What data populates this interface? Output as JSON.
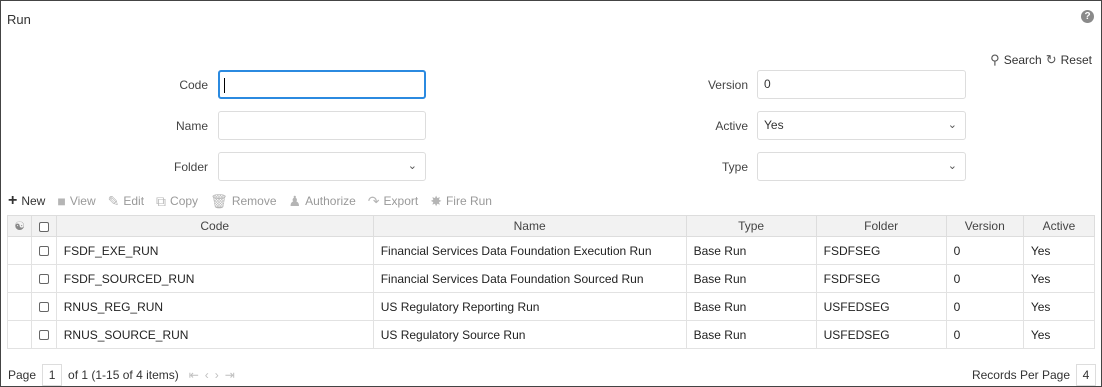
{
  "page": {
    "title": "Run",
    "help_icon": "question-icon"
  },
  "top_actions": {
    "search_label": "Search",
    "reset_label": "Reset"
  },
  "form": {
    "code_label": "Code",
    "code_value": "",
    "name_label": "Name",
    "name_value": "",
    "folder_label": "Folder",
    "folder_value": "",
    "version_label": "Version",
    "version_value": "0",
    "active_label": "Active",
    "active_value": "Yes",
    "type_label": "Type",
    "type_value": ""
  },
  "toolbar": {
    "new": "New",
    "view": "View",
    "edit": "Edit",
    "copy": "Copy",
    "remove": "Remove",
    "authorize": "Authorize",
    "export": "Export",
    "fire_run": "Fire Run"
  },
  "table": {
    "headers": [
      "Code",
      "Name",
      "Type",
      "Folder",
      "Version",
      "Active"
    ],
    "rows": [
      [
        "FSDF_EXE_RUN",
        "Financial Services Data Foundation Execution Run",
        "Base Run",
        "FSDFSEG",
        "0",
        "Yes"
      ],
      [
        "FSDF_SOURCED_RUN",
        "Financial Services Data Foundation Sourced Run",
        "Base Run",
        "FSDFSEG",
        "0",
        "Yes"
      ],
      [
        "RNUS_REG_RUN",
        "US Regulatory Reporting Run",
        "Base Run",
        "USFEDSEG",
        "0",
        "Yes"
      ],
      [
        "RNUS_SOURCE_RUN",
        "US Regulatory Source Run",
        "Base Run",
        "USFEDSEG",
        "0",
        "Yes"
      ]
    ]
  },
  "pager": {
    "page_label": "Page",
    "page_value": "1",
    "of_text": "of 1 (1-15 of 4 items)",
    "records_label": "Records Per Page",
    "records_value": "4"
  }
}
